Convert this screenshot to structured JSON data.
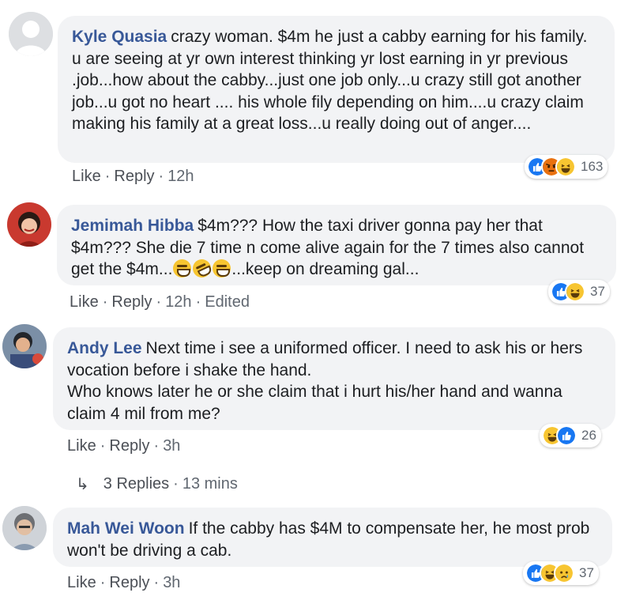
{
  "comments": [
    {
      "author": "Kyle Quasia",
      "text": "crazy woman. $4m he just a cabby earning for his family. u are seeing at yr own interest thinking yr lost earning in yr previous .job...how about the cabby...just one job only...u crazy still got another job...u got no heart .... his whole fily depending on him....u crazy claim making his family at a great loss...u really doing out of anger....",
      "like": "Like",
      "reply": "Reply",
      "time": "12h",
      "reaction_count": "163",
      "reactions": [
        "like-icon",
        "angry-icon",
        "haha-icon"
      ]
    },
    {
      "author": "Jemimah Hibba",
      "text_parts": [
        "$4m??? How the taxi driver gonna pay her that $4m??? She die 7 time n come alive again for the 7 times also cannot get the $4m...",
        "...keep on dreaming gal..."
      ],
      "emojis": [
        "joy-emoji",
        "rofl-emoji",
        "joy-emoji"
      ],
      "like": "Like",
      "reply": "Reply",
      "time": "12h",
      "edited": "Edited",
      "reaction_count": "37",
      "reactions": [
        "like-icon",
        "haha-icon"
      ]
    },
    {
      "author": "Andy Lee",
      "text": "Next time i see a uniformed officer. I need to ask his or hers vocation before i shake the hand.\nWho knows later he or she claim that i hurt his/her hand and wanna claim 4 mil from me?",
      "like": "Like",
      "reply": "Reply",
      "time": "3h",
      "reaction_count": "26",
      "reactions": [
        "haha-icon",
        "like-icon"
      ],
      "replies_label": "3 Replies",
      "replies_time": "13 mins"
    },
    {
      "author": "Mah Wei Woon",
      "text": "If the cabby has $4M to compensate her, he most prob won't be driving a cab.",
      "like": "Like",
      "reply": "Reply",
      "time": "3h",
      "reaction_count": "37",
      "reactions": [
        "like-icon",
        "haha-icon",
        "sad-icon"
      ]
    }
  ],
  "colors": {
    "author": "#385898",
    "bubble": "#f2f3f5",
    "meta": "#606770",
    "like": "#1877f2",
    "haha": "#f7c531",
    "angry": "#e9710f"
  }
}
